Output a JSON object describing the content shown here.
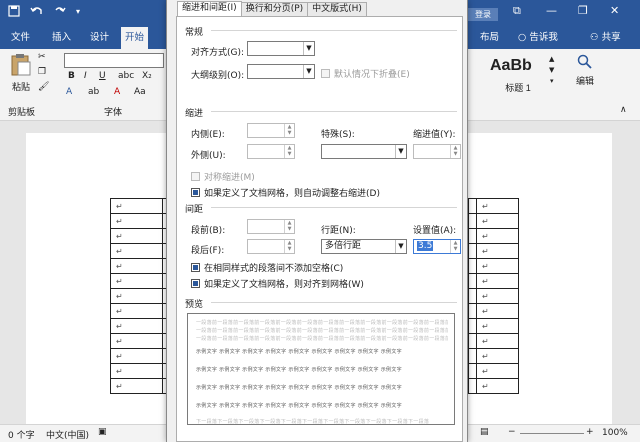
{
  "titlebar": {
    "login_label": "登录",
    "min_icon": "minimize-icon",
    "restore_icon": "restore-icon",
    "close_icon": "close-icon"
  },
  "ribbon_tabs": [
    "文件",
    "插入",
    "设计",
    "开始",
    "布局",
    "告诉我",
    "共享"
  ],
  "ribbon": {
    "paste_label": "粘贴",
    "clipboard_label": "剪贴板",
    "font_group_label": "字体",
    "style_preview": "AaBb",
    "style_name": "标题 1",
    "edit_label": "编辑"
  },
  "dialog": {
    "tabs": [
      "缩进和间距(I)",
      "换行和分页(P)",
      "中文版式(H)"
    ],
    "general": {
      "title": "常规",
      "align_label": "对齐方式(G):",
      "outline_label": "大纲级别(O):",
      "collapse_label": "默认情况下折叠(E)"
    },
    "indent": {
      "title": "缩进",
      "inside_label": "内侧(E):",
      "outside_label": "外侧(U):",
      "special_label": "特殊(S):",
      "value_label": "缩进值(Y):",
      "mirror_label": "对称缩进(M)",
      "auto_adjust_label": "如果定义了文档网格，则自动调整右缩进(D)"
    },
    "spacing": {
      "title": "间距",
      "before_label": "段前(B):",
      "after_label": "段后(F):",
      "line_spacing_label": "行距(N):",
      "line_spacing_value": "多倍行距",
      "setting_label": "设置值(A):",
      "setting_value": "3.5",
      "no_space_label": "在相同样式的段落间不添加空格(C)",
      "snap_grid_label": "如果定义了文档网格，则对齐到网格(W)"
    },
    "preview": {
      "title": "预览",
      "prev_text": "一段落前一段落前一段落前一段落前一段落前一段落前一段落前一段落前一段落前一段落前一段落前一段落前",
      "sample_text": "示例文字 示例文字 示例文字 示例文字 示例文字 示例文字 示例文字 示例文字 示例文字",
      "next_text": "下一段落下一段落下一段落下一段落下一段落下一段落下一段落下一段落下一段落下一段落下一段落"
    }
  },
  "statusbar": {
    "word_count": "0 个字",
    "language": "中文(中国)",
    "zoom": "100%"
  },
  "colors": {
    "brand": "#2b579a",
    "selection": "#3d7ad6"
  }
}
